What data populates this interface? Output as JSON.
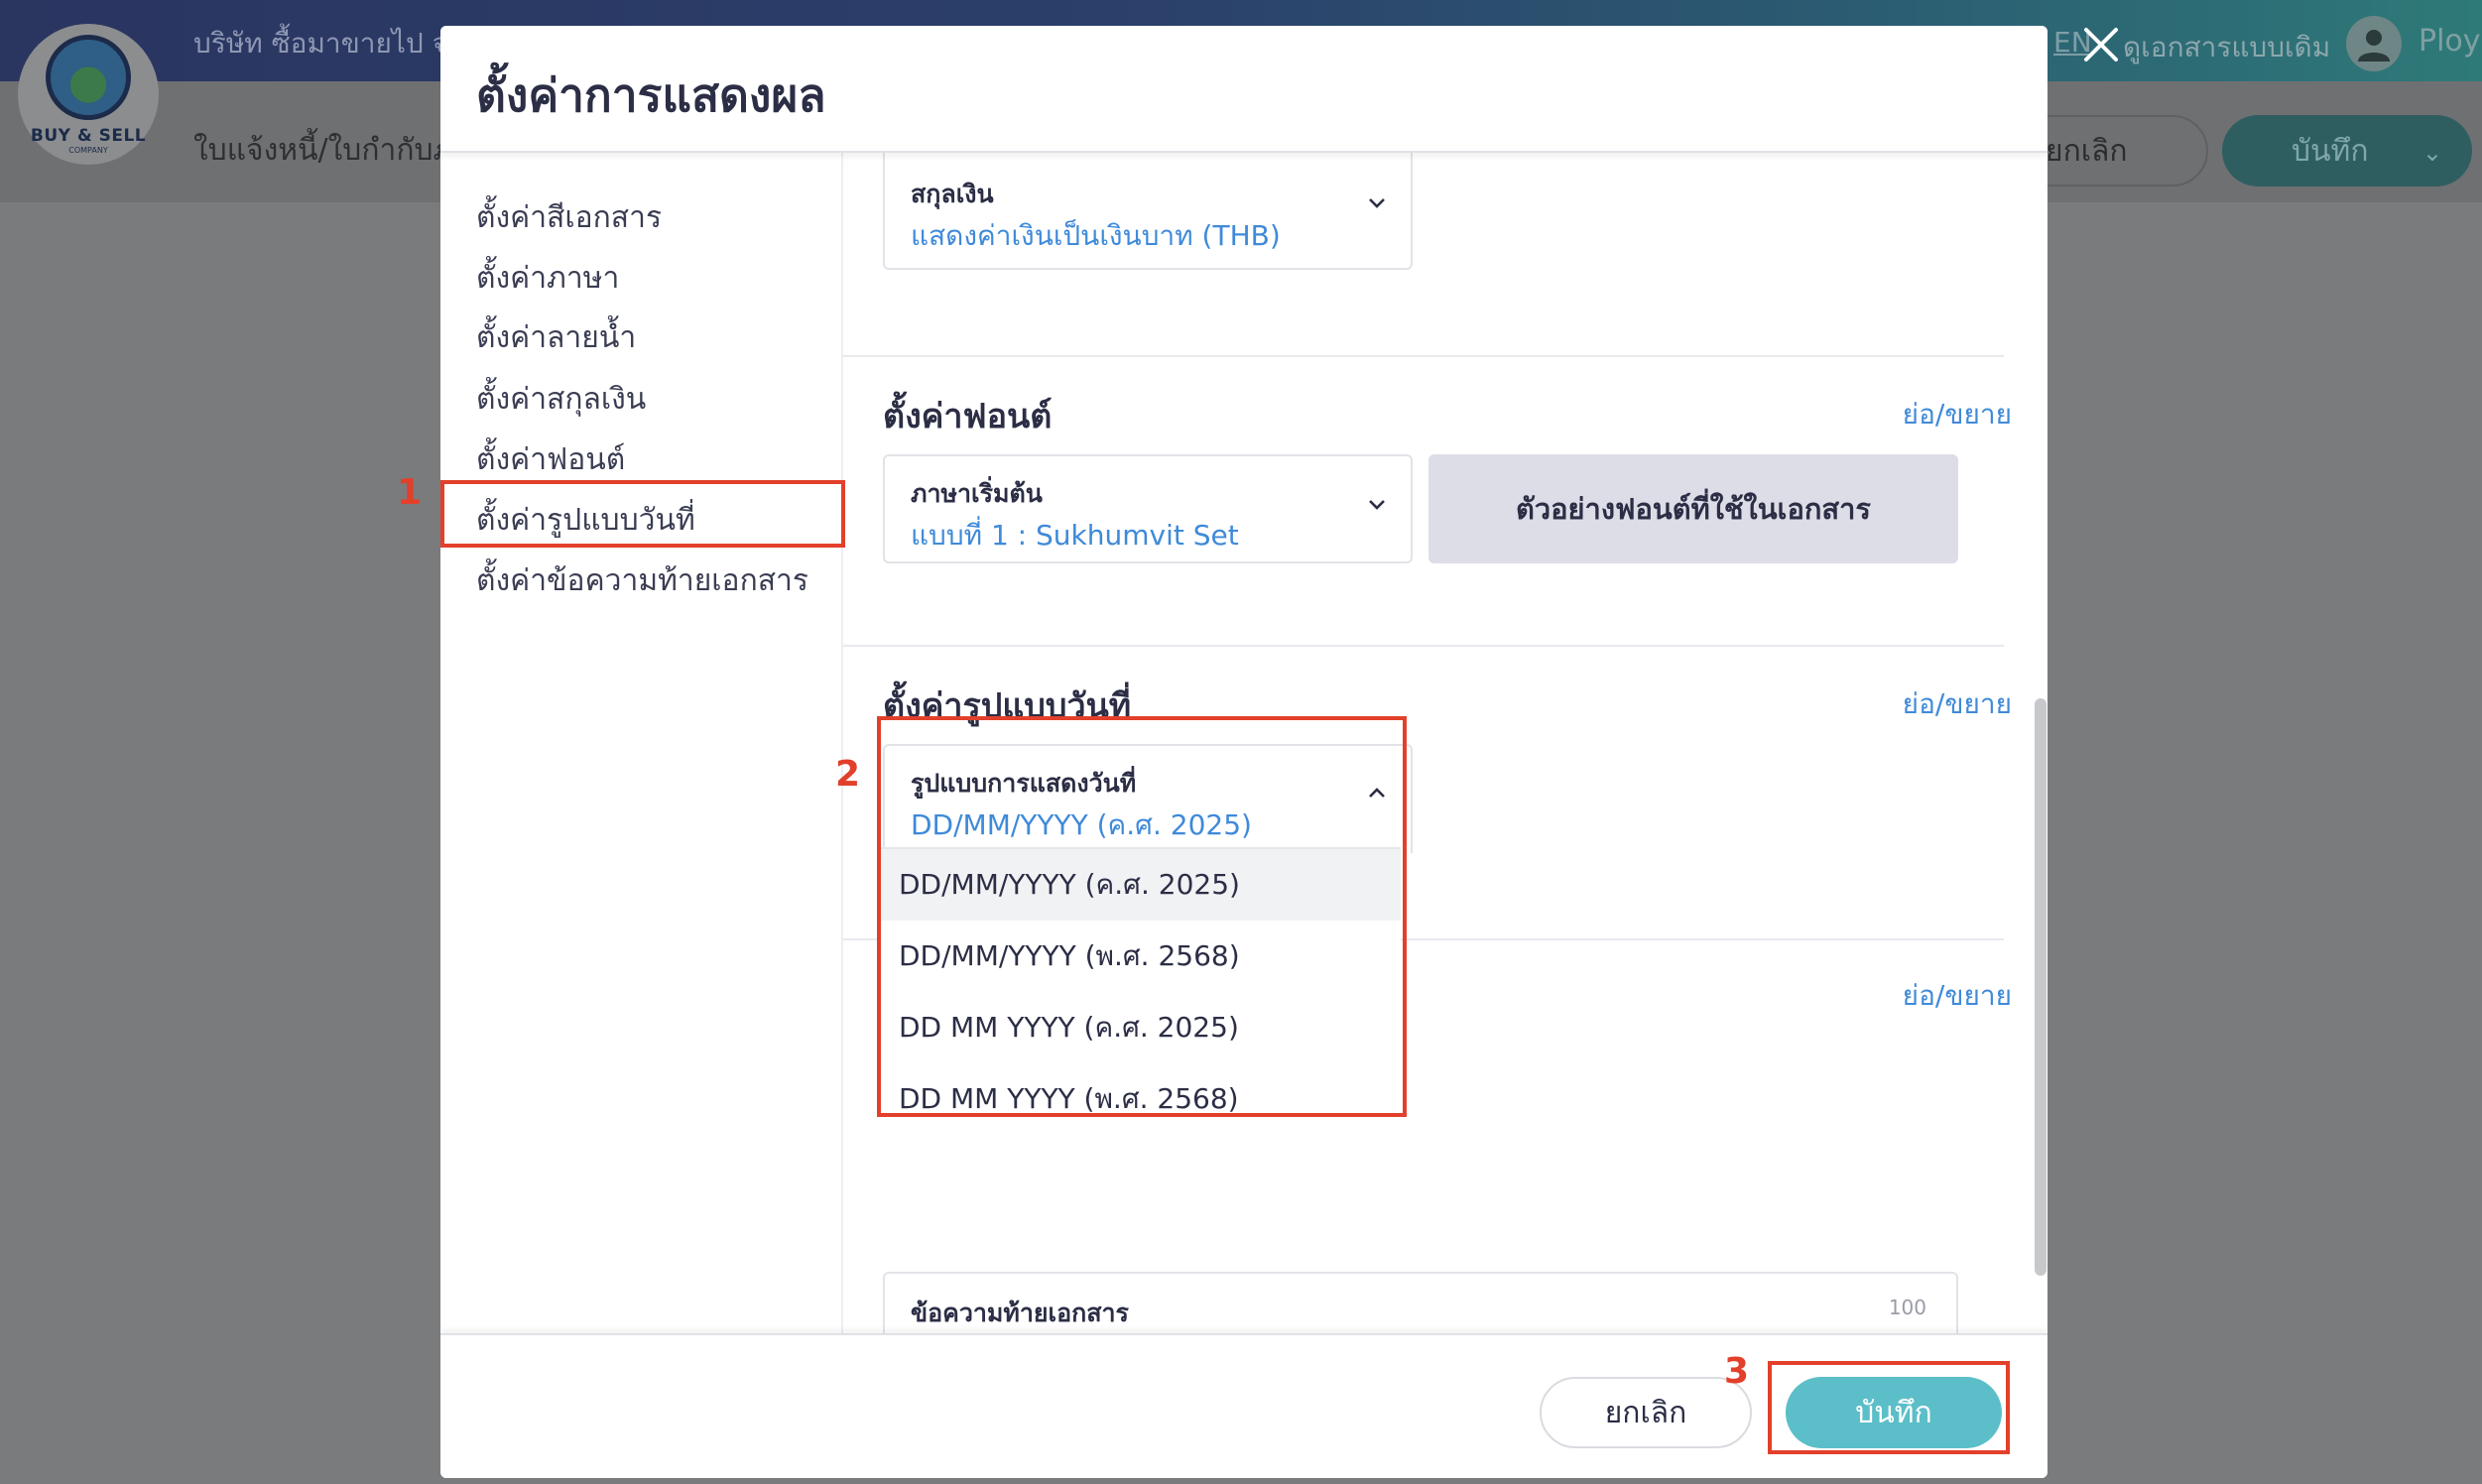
{
  "app": {
    "logo_text": "BUY & SELL",
    "logo_sub": "COMPANY",
    "company_name": "บริษัท ซื้อมาขายไป จำ",
    "doc_type": "ใบแจ้งหนี้/ใบกำกับภาษี",
    "lang_link": "EN",
    "old_doc_link": "ดูเอกสารแบบเดิม",
    "user_name": "Ploy",
    "cancel_label": "ยกเลิก",
    "save_label": "บันทึก"
  },
  "modal": {
    "title": "ตั้งค่าการแสดงผล",
    "nav": [
      {
        "label": "ตั้งค่าสีเอกสาร"
      },
      {
        "label": "ตั้งค่าภาษา"
      },
      {
        "label": "ตั้งค่าลายน้ำ"
      },
      {
        "label": "ตั้งค่าสกุลเงิน"
      },
      {
        "label": "ตั้งค่าฟอนต์"
      },
      {
        "label": "ตั้งค่ารูปแบบวันที่"
      },
      {
        "label": "ตั้งค่าข้อความท้ายเอกสาร"
      }
    ],
    "currency": {
      "label": "สกุลเงิน",
      "value": "แสดงค่าเงินเป็นเงินบาท (THB)"
    },
    "font_section": {
      "title": "ตั้งค่าฟอนต์",
      "toggle": "ย่อ/ขยาย",
      "select_label": "ภาษาเริ่มต้น",
      "select_value": "แบบที่ 1 : Sukhumvit Set",
      "preview_button": "ตัวอย่างฟอนต์ที่ใช้ในเอกสาร"
    },
    "date_section": {
      "title": "ตั้งค่ารูปแบบวันที่",
      "toggle": "ย่อ/ขยาย",
      "select_label": "รูปแบบการแสดงวันที่",
      "select_value": "DD/MM/YYYY (ค.ศ. 2025)",
      "options": [
        "DD/MM/YYYY (ค.ศ. 2025)",
        "DD/MM/YYYY (พ.ศ. 2568)",
        "DD MM YYYY (ค.ศ. 2025)",
        "DD MM YYYY (พ.ศ. 2568)"
      ]
    },
    "footer_section": {
      "toggle": "ย่อ/ขยาย",
      "field_label": "ข้อความท้ายเอกสาร",
      "char_limit": "100"
    },
    "footer": {
      "cancel": "ยกเลิก",
      "save": "บันทึก"
    }
  },
  "annotations": [
    "1",
    "2",
    "3"
  ],
  "colors": {
    "accent_blue": "#3f8ad9",
    "save_teal": "#5bbec8",
    "highlight_red": "#e2402b"
  }
}
